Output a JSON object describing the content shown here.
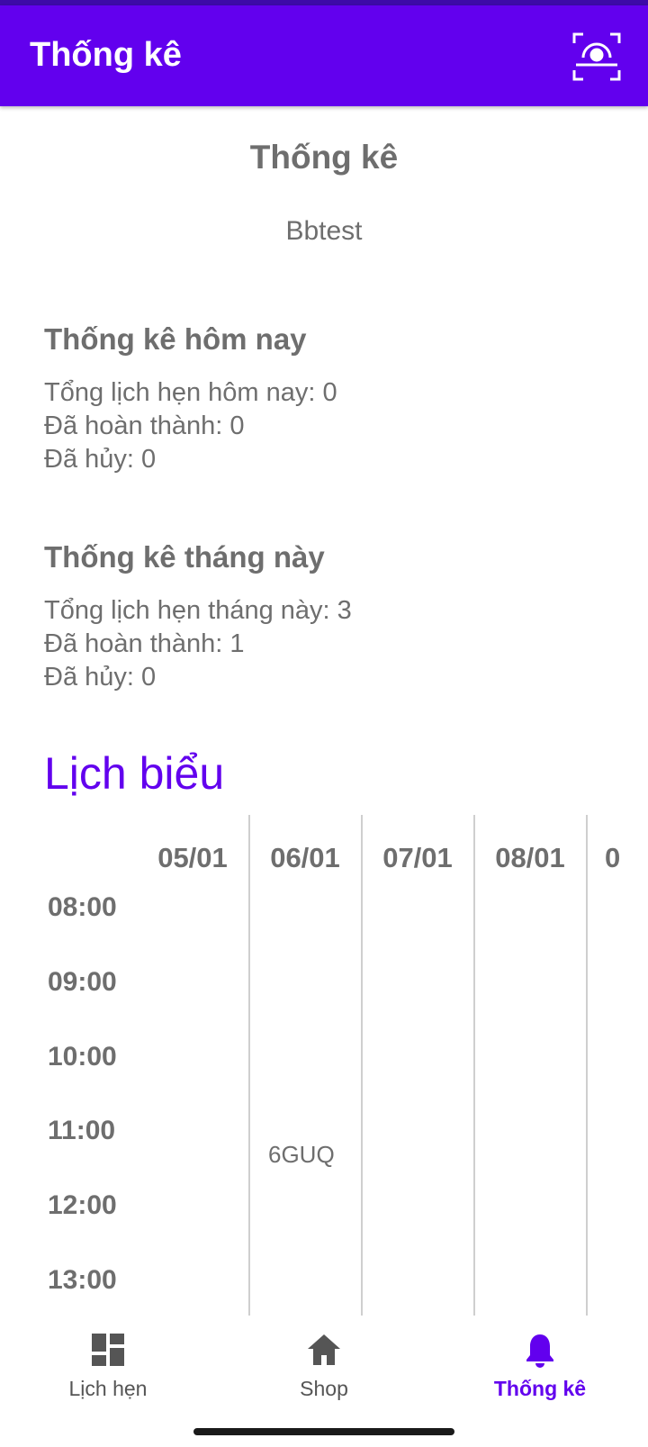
{
  "appbar": {
    "title": "Thống kê",
    "action_icon": "face-scan-icon"
  },
  "header": {
    "title": "Thống kê",
    "subtitle": "Bbtest"
  },
  "today": {
    "title": "Thống kê hôm nay",
    "total": "Tổng lịch hẹn hôm nay: 0",
    "completed": "Đã hoàn thành: 0",
    "cancelled": "Đã hủy: 0"
  },
  "month": {
    "title": "Thống kê tháng này",
    "total": "Tổng lịch hẹn tháng này: 3",
    "completed": "Đã hoàn thành: 1",
    "cancelled": "Đã hủy: 0"
  },
  "schedule": {
    "title": "Lịch biểu",
    "days": [
      "05/01",
      "06/01",
      "07/01",
      "08/01",
      "0"
    ],
    "times": [
      "08:00",
      "09:00",
      "10:00",
      "11:00",
      "12:00",
      "13:00"
    ],
    "appointment": {
      "label": "6GUQ",
      "day": "06/01",
      "time": "11:00"
    }
  },
  "bottom_nav": {
    "items": [
      {
        "label": "Lịch hẹn",
        "icon": "dashboard-icon",
        "active": false
      },
      {
        "label": "Shop",
        "icon": "home-icon",
        "active": false
      },
      {
        "label": "Thống kê",
        "icon": "bell-icon",
        "active": true
      }
    ]
  },
  "colors": {
    "primary": "#6200ee",
    "text_gray": "#6e6e6e",
    "grid_line": "#cfcfcf"
  }
}
